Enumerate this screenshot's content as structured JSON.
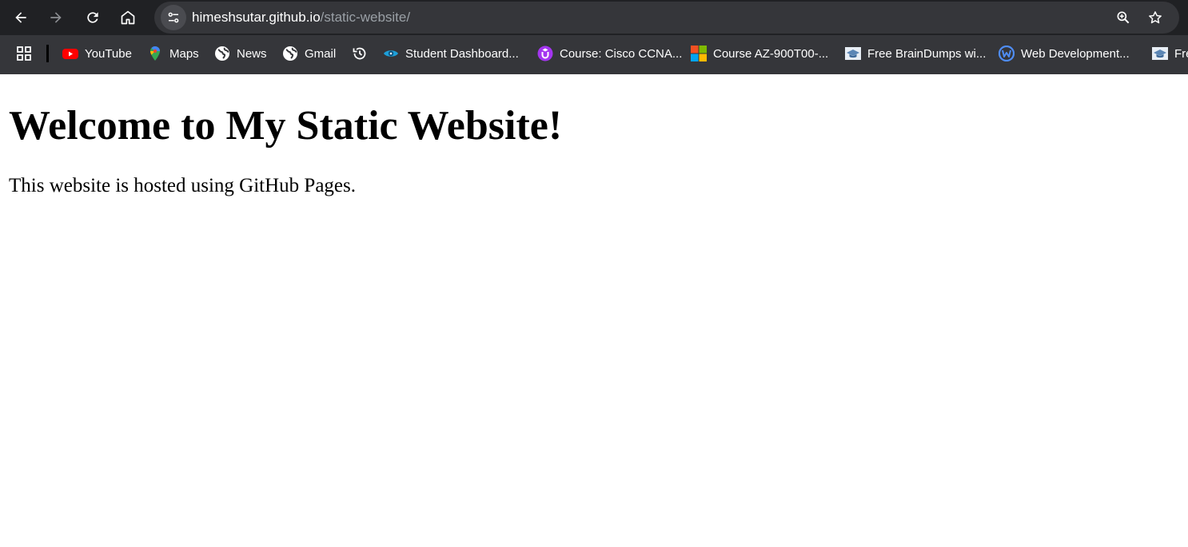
{
  "browser": {
    "url_host": "himeshsutar.github.io",
    "url_path": "/static-website/",
    "icons": {
      "back": "arrow-left-icon",
      "forward": "arrow-right-icon",
      "reload": "reload-icon",
      "home": "home-icon",
      "site_info": "site-info-icon",
      "zoom": "zoom-icon",
      "bookmark_star": "star-icon",
      "apps": "apps-grid-icon"
    },
    "colors": {
      "toolbar_bg": "#202124",
      "bookmarks_bg": "#35363a",
      "omnibox_bg": "#35363a",
      "url_path": "#9aa0a6"
    }
  },
  "bookmarks": {
    "items": [
      {
        "label": "YouTube",
        "icon": "youtube-icon"
      },
      {
        "label": "Maps",
        "icon": "maps-pin-icon"
      },
      {
        "label": "News",
        "icon": "globe-icon"
      },
      {
        "label": "Gmail",
        "icon": "globe-icon"
      },
      {
        "label": "",
        "icon": "history-icon"
      },
      {
        "label": "Student Dashboard...",
        "icon": "eye-icon"
      },
      {
        "label": "Course: Cisco CCNA...",
        "icon": "udemy-icon"
      },
      {
        "label": "Course AZ-900T00-...",
        "icon": "microsoft-icon"
      },
      {
        "label": "Free BrainDumps wi...",
        "icon": "graduation-cap-icon"
      },
      {
        "label": "Web Development...",
        "icon": "w-logo-icon"
      },
      {
        "label": "Fre",
        "icon": "graduation-cap-icon"
      }
    ]
  },
  "page": {
    "heading": "Welcome to My Static Website!",
    "paragraph": "This website is hosted using GitHub Pages."
  }
}
